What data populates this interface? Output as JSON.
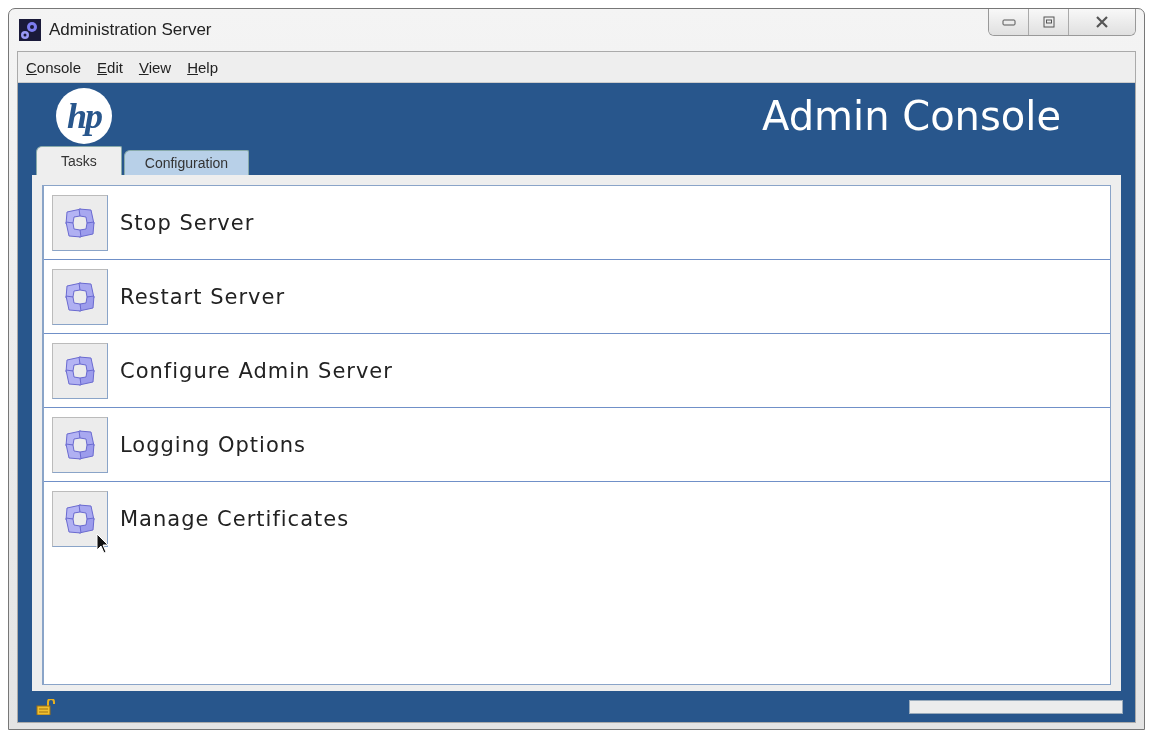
{
  "window": {
    "title": "Administration Server"
  },
  "menu": [
    "Console",
    "Edit",
    "View",
    "Help"
  ],
  "header": {
    "logo": "hp",
    "title": "Admin Console"
  },
  "tabs": [
    {
      "label": "Tasks",
      "selected": true
    },
    {
      "label": "Configuration",
      "selected": false
    }
  ],
  "tasks": [
    {
      "label": "Stop Server",
      "hovered": false
    },
    {
      "label": "Restart Server",
      "hovered": false
    },
    {
      "label": "Configure Admin Server",
      "hovered": false
    },
    {
      "label": "Logging Options",
      "hovered": false
    },
    {
      "label": "Manage Certificates",
      "hovered": true
    }
  ]
}
